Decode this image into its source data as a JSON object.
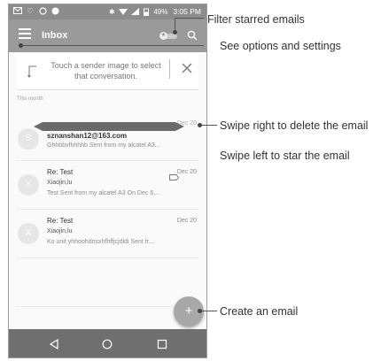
{
  "status_bar": {
    "battery": "49%",
    "time": "3:05 PM"
  },
  "app_bar": {
    "title": "Inbox"
  },
  "tip": {
    "text": "Touch a sender image to select that conversation."
  },
  "section": {
    "label": "This month"
  },
  "emails": [
    {
      "avatar": "S",
      "sender": "sznanshan12@163.com",
      "date": "Dec 20",
      "subject": "",
      "snippet": "Ghhbbvfhhhhb Sent from my alcatel A3..."
    },
    {
      "avatar": "X",
      "sender": "Re: Test",
      "date": "Dec 20",
      "subject": "Xiaojin,lu",
      "snippet": "Test Sent from my alcatel A3 On Dec 6,..."
    },
    {
      "avatar": "X",
      "sender": "Re: Test",
      "date": "Dec 20",
      "subject": "Xiaojin,lu",
      "snippet": "Ko unit yhhoohdnsxhfhffjcjdidi Sent fr..."
    }
  ],
  "fab": {
    "label": "+"
  },
  "callouts": {
    "filter": "Filter starred emails",
    "options": "See options and settings",
    "swipe_delete": "Swipe right to delete the email",
    "swipe_star": "Swipe left to star the email",
    "create": "Create an email"
  },
  "icons": {
    "menu": "menu-icon",
    "search": "search-icon",
    "close": "close-icon",
    "back": "back-icon",
    "home": "home-icon",
    "recent": "recent-apps-icon"
  },
  "colors": {
    "app_bar": "#9a9a9a",
    "status_bar": "#8c8c8c",
    "nav_bar": "#6f6f6f",
    "fab": "#a8a8a8"
  }
}
